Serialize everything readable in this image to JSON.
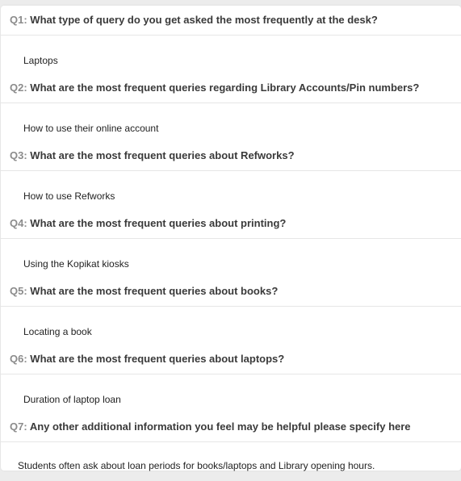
{
  "items": [
    {
      "num": "Q1:",
      "question": "What type of query do you get asked the most frequently at the desk?",
      "answer": "Laptops"
    },
    {
      "num": "Q2:",
      "question": "What are the most frequent queries regarding Library Accounts/Pin numbers?",
      "answer": "How to use their online account"
    },
    {
      "num": "Q3:",
      "question": "What are the most frequent queries about Refworks?",
      "answer": "How to use Refworks"
    },
    {
      "num": "Q4:",
      "question": "What are the most frequent queries about printing?",
      "answer": "Using the Kopikat kiosks"
    },
    {
      "num": "Q5:",
      "question": "What are the most frequent queries about books?",
      "answer": "Locating a book"
    },
    {
      "num": "Q6:",
      "question": "What are the most frequent queries about laptops?",
      "answer": "Duration of laptop loan"
    },
    {
      "num": "Q7:",
      "question": "Any other additional information you feel may be helpful please specify here",
      "answer": "Students often ask about loan periods for books/laptops and Library opening hours."
    }
  ]
}
